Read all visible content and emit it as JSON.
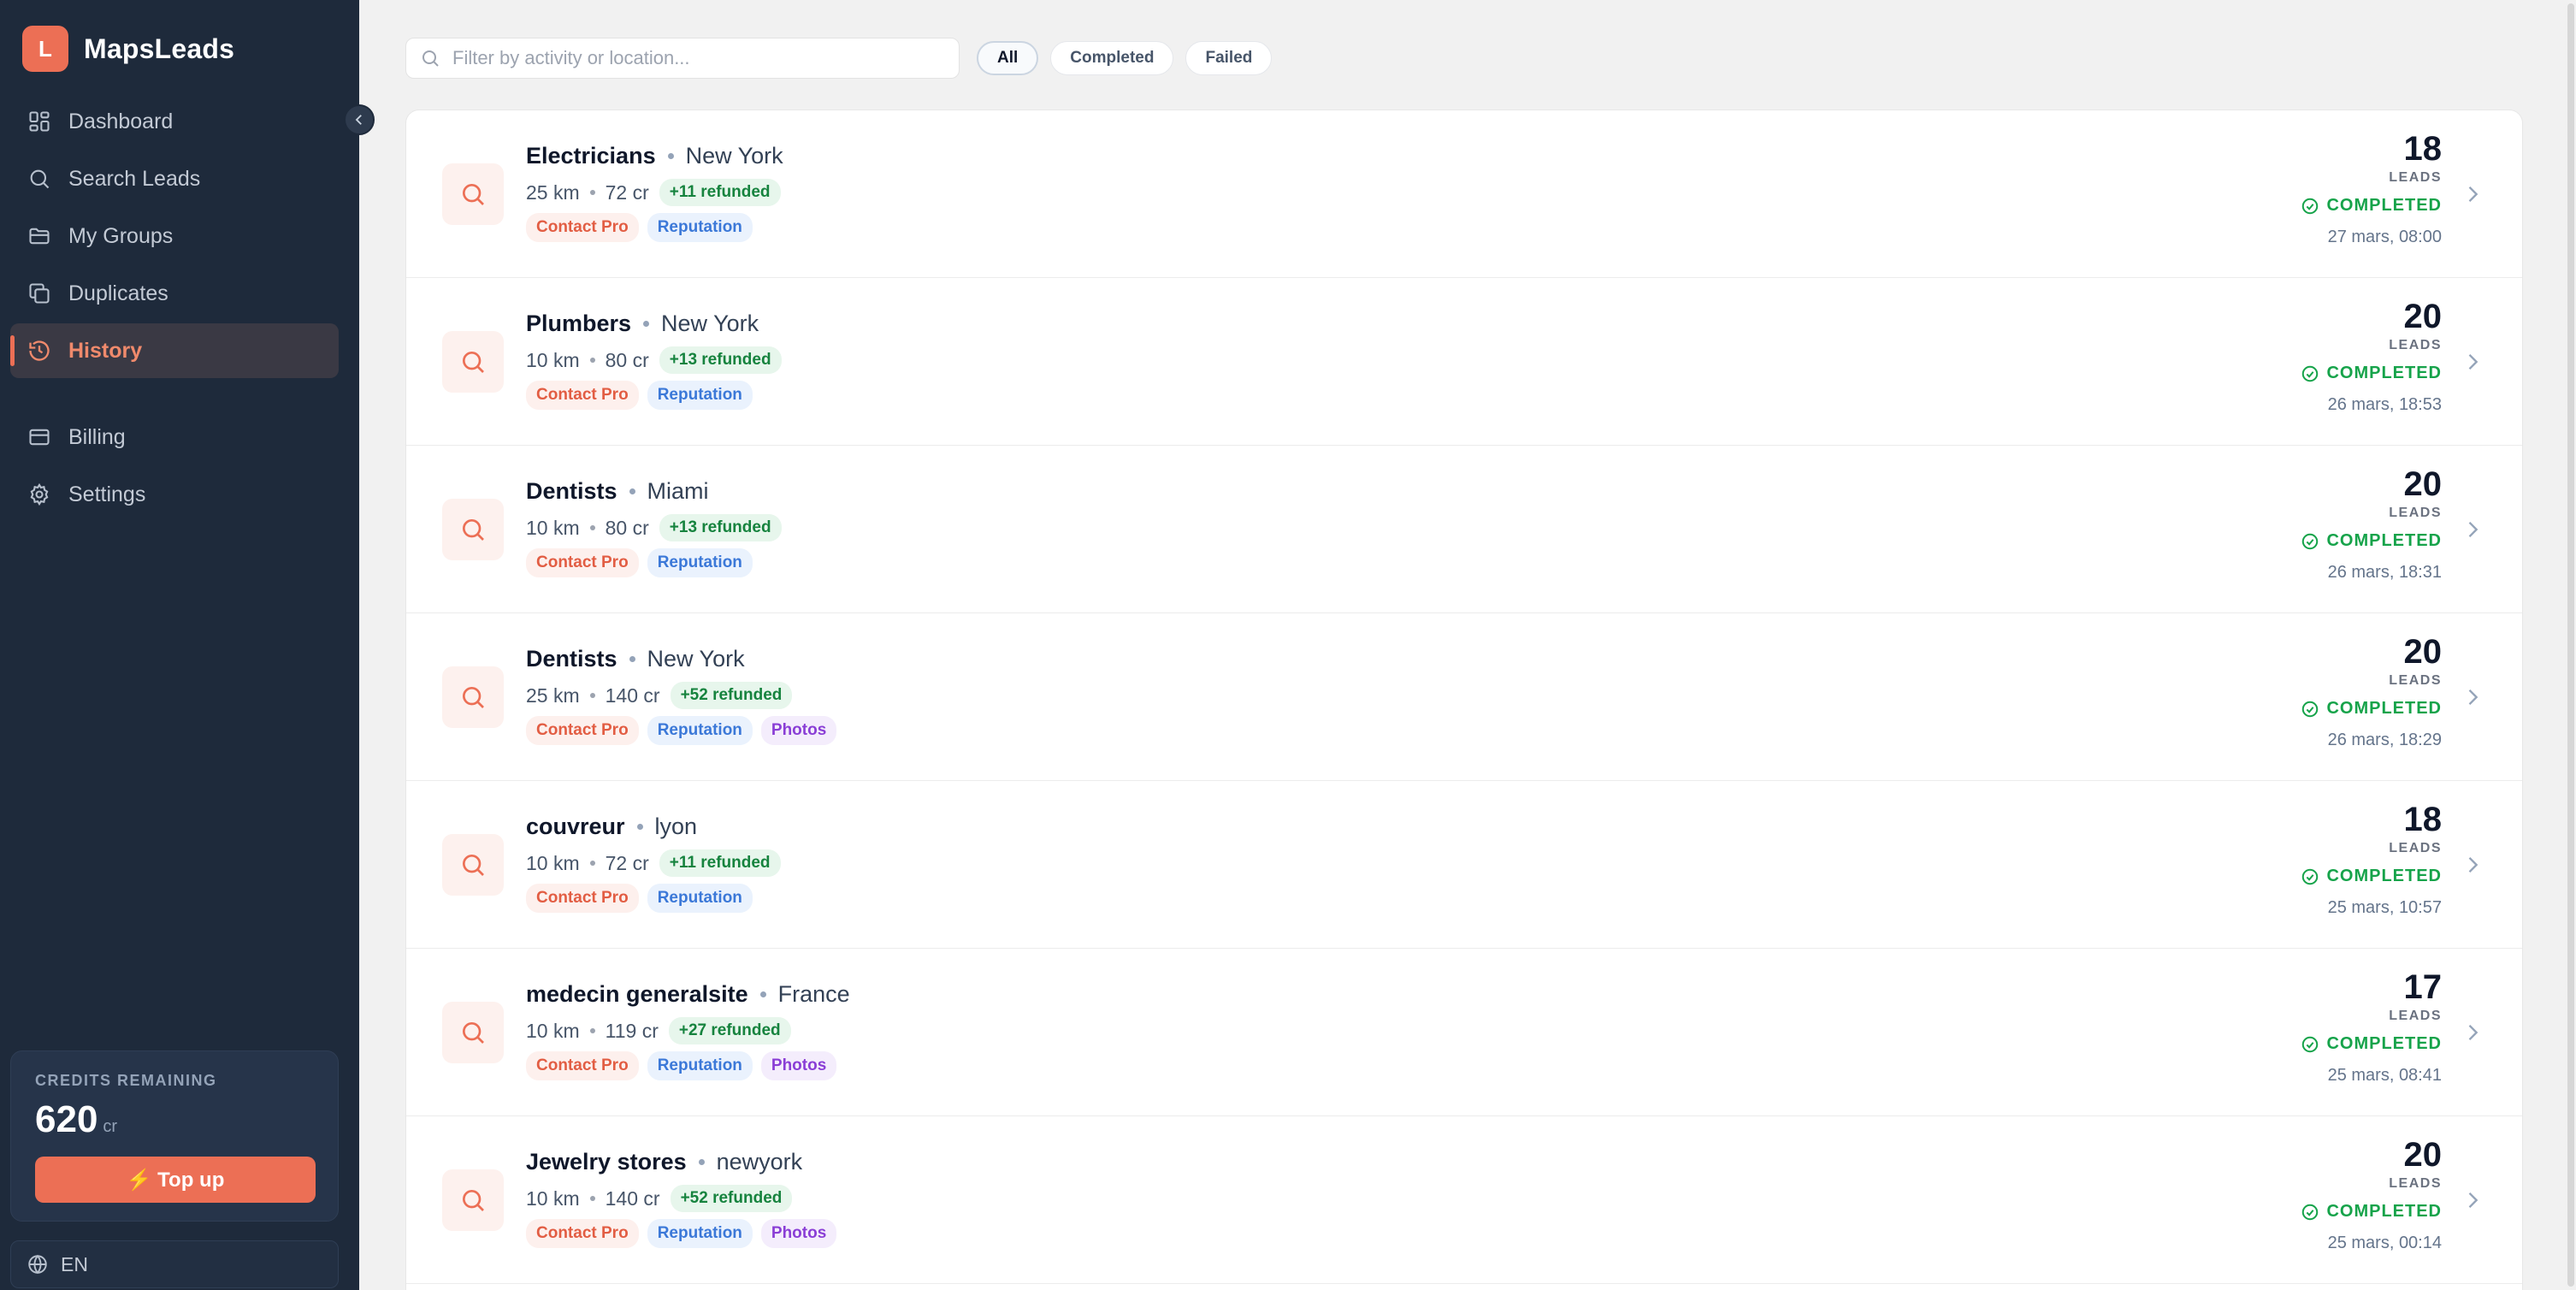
{
  "app": {
    "logo_letter": "L",
    "name": "MapsLeads"
  },
  "sidebar": {
    "items": [
      {
        "label": "Dashboard"
      },
      {
        "label": "Search Leads"
      },
      {
        "label": "My Groups"
      },
      {
        "label": "Duplicates"
      },
      {
        "label": "History",
        "active": true
      },
      {
        "label": "Billing"
      },
      {
        "label": "Settings"
      }
    ],
    "credits": {
      "label": "CREDITS REMAINING",
      "value": "620",
      "unit": "cr",
      "topup_label": "⚡ Top up"
    },
    "language": "EN"
  },
  "filters": {
    "search_placeholder": "Filter by activity or location...",
    "chips": [
      {
        "label": "All",
        "active": true
      },
      {
        "label": "Completed"
      },
      {
        "label": "Failed"
      }
    ]
  },
  "history": {
    "leads_label": "LEADS",
    "rows": [
      {
        "activity": "Electricians",
        "location": "New York",
        "radius": "25 km",
        "cost": "72 cr",
        "refund": "+11 refunded",
        "tags": [
          "Contact Pro",
          "Reputation"
        ],
        "leads": "18",
        "status": "COMPLETED",
        "date": "27 mars, 08:00"
      },
      {
        "activity": "Plumbers",
        "location": "New York",
        "radius": "10 km",
        "cost": "80 cr",
        "refund": "+13 refunded",
        "tags": [
          "Contact Pro",
          "Reputation"
        ],
        "leads": "20",
        "status": "COMPLETED",
        "date": "26 mars, 18:53"
      },
      {
        "activity": "Dentists",
        "location": "Miami",
        "radius": "10 km",
        "cost": "80 cr",
        "refund": "+13 refunded",
        "tags": [
          "Contact Pro",
          "Reputation"
        ],
        "leads": "20",
        "status": "COMPLETED",
        "date": "26 mars, 18:31"
      },
      {
        "activity": "Dentists",
        "location": "New York",
        "radius": "25 km",
        "cost": "140 cr",
        "refund": "+52 refunded",
        "tags": [
          "Contact Pro",
          "Reputation",
          "Photos"
        ],
        "leads": "20",
        "status": "COMPLETED",
        "date": "26 mars, 18:29"
      },
      {
        "activity": "couvreur",
        "location": "lyon",
        "radius": "10 km",
        "cost": "72 cr",
        "refund": "+11 refunded",
        "tags": [
          "Contact Pro",
          "Reputation"
        ],
        "leads": "18",
        "status": "COMPLETED",
        "date": "25 mars, 10:57"
      },
      {
        "activity": "medecin generalsite",
        "location": "France",
        "radius": "10 km",
        "cost": "119 cr",
        "refund": "+27 refunded",
        "tags": [
          "Contact Pro",
          "Reputation",
          "Photos"
        ],
        "leads": "17",
        "status": "COMPLETED",
        "date": "25 mars, 08:41"
      },
      {
        "activity": "Jewelry stores",
        "location": "newyork",
        "radius": "10 km",
        "cost": "140 cr",
        "refund": "+52 refunded",
        "tags": [
          "Contact Pro",
          "Reputation",
          "Photos"
        ],
        "leads": "20",
        "status": "COMPLETED",
        "date": "25 mars, 00:14"
      }
    ]
  },
  "colors": {
    "sidebar_bg": "#1e2a3b",
    "accent": "#ec6f55",
    "success": "#16a34a"
  }
}
